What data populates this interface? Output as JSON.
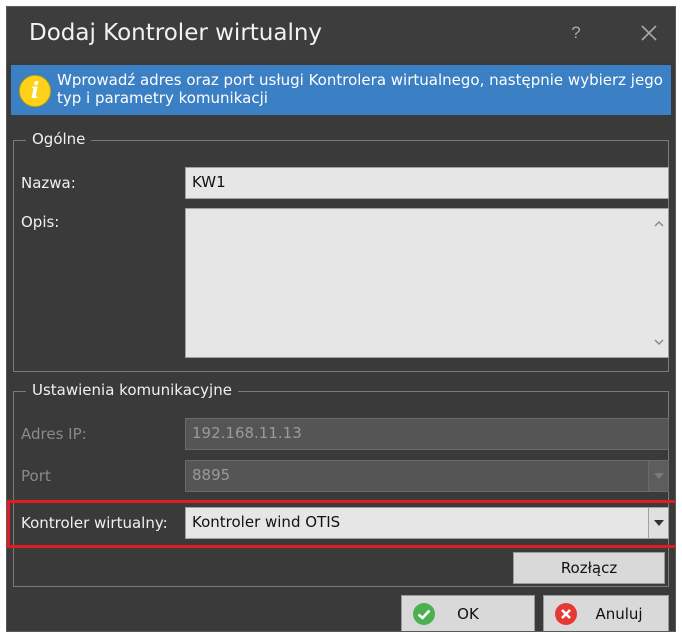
{
  "window": {
    "title": "Dodaj Kontroler wirtualny",
    "help_label": "?"
  },
  "info": {
    "icon": "info-icon",
    "icon_glyph": "i",
    "text": "Wprowadź adres oraz port usługi Kontrolera wirtualnego, następnie wybierz jego typ i parametry komunikacji"
  },
  "general": {
    "title": "Ogólne",
    "name_label": "Nazwa:",
    "name_value": "KW1",
    "description_label": "Opis:",
    "description_value": ""
  },
  "communication": {
    "title": "Ustawienia komunikacyjne",
    "ip_label": "Adres IP:",
    "ip_value": "192.168.11.13",
    "port_label": "Port",
    "port_value": "8895",
    "controller_label": "Kontroler wirtualny:",
    "controller_value": "Kontroler wind OTIS",
    "disconnect_label": "Rozłącz"
  },
  "footer": {
    "ok_label": "OK",
    "cancel_label": "Anuluj"
  },
  "colors": {
    "banner": "#3b7fc4",
    "highlight": "#e11b22",
    "ok_icon": "#4caf50",
    "cancel_icon": "#e53935"
  }
}
